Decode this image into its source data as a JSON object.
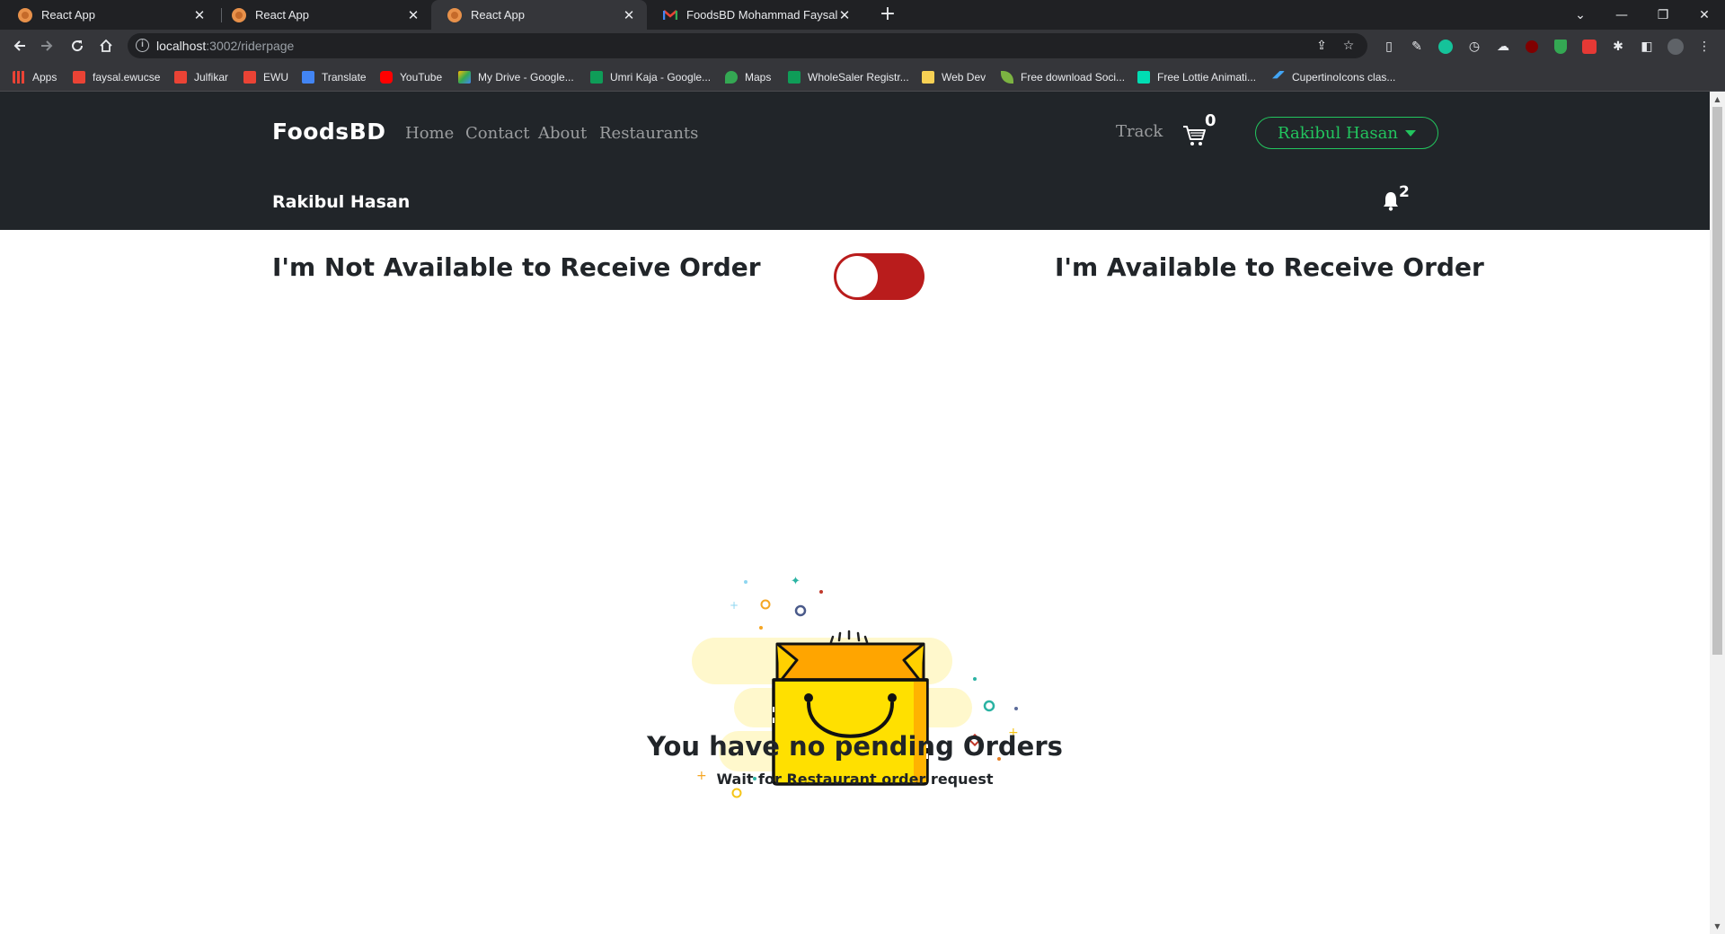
{
  "browser": {
    "tabs": [
      {
        "title": "React App",
        "active": false
      },
      {
        "title": "React App",
        "active": false
      },
      {
        "title": "React App",
        "active": true
      },
      {
        "title": "FoodsBD Mohammad Faysal - fa",
        "active": false
      }
    ],
    "url_host": "localhost",
    "url_path": ":3002/riderpage",
    "bookmarks": [
      "Apps",
      "faysal.ewucse",
      "Julfikar",
      "EWU",
      "Translate",
      "YouTube",
      "My Drive - Google...",
      "Umri Kaja - Google...",
      "Maps",
      "WholeSaler Registr...",
      "Web Dev",
      "Free download Soci...",
      "Free Lottie Animati...",
      "CupertinoIcons clas..."
    ]
  },
  "nav": {
    "brand": "FoodsBD",
    "links": [
      "Home",
      "Contact",
      "About",
      "Restaurants"
    ],
    "track": "Track",
    "cart_count": "0",
    "user_name": "Rakibul Hasan"
  },
  "rider": {
    "name": "Rakibul Hasan",
    "notification_count": "2"
  },
  "availability": {
    "not_available_label": "I'm Not Available to Receive Order",
    "available_label": "I'm Available to Receive Order",
    "is_available": false,
    "toggle_color": "#b91c1c"
  },
  "empty_state": {
    "title": "You have no pending Orders",
    "subtitle": "Wait for Restaurant order request"
  },
  "colors": {
    "header_bg": "#212529",
    "accent_green": "#22c55e"
  }
}
